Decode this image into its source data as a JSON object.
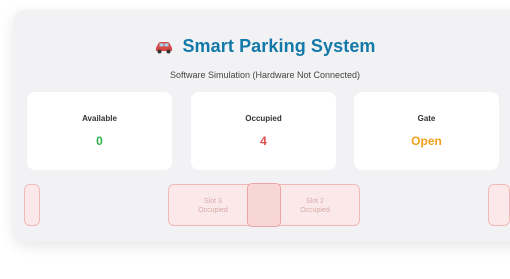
{
  "header": {
    "title": "Smart Parking System",
    "subtitle": "Software Simulation (Hardware Not Connected)",
    "icon": "car-icon"
  },
  "stats": [
    {
      "label": "Available",
      "value": "0",
      "color": "#2fb24c"
    },
    {
      "label": "Occupied",
      "value": "4",
      "color": "#e04c4c"
    },
    {
      "label": "Gate",
      "value": "Open",
      "color": "#f2a01d"
    }
  ],
  "slots": [
    {
      "name": "Slot 3",
      "status": "Occupied"
    },
    {
      "name": "Slot 2",
      "status": "Occupied"
    }
  ],
  "colors": {
    "accent": "#1279a8",
    "available": "#2fb24c",
    "occupied": "#e04c4c",
    "gate": "#f2a01d"
  }
}
